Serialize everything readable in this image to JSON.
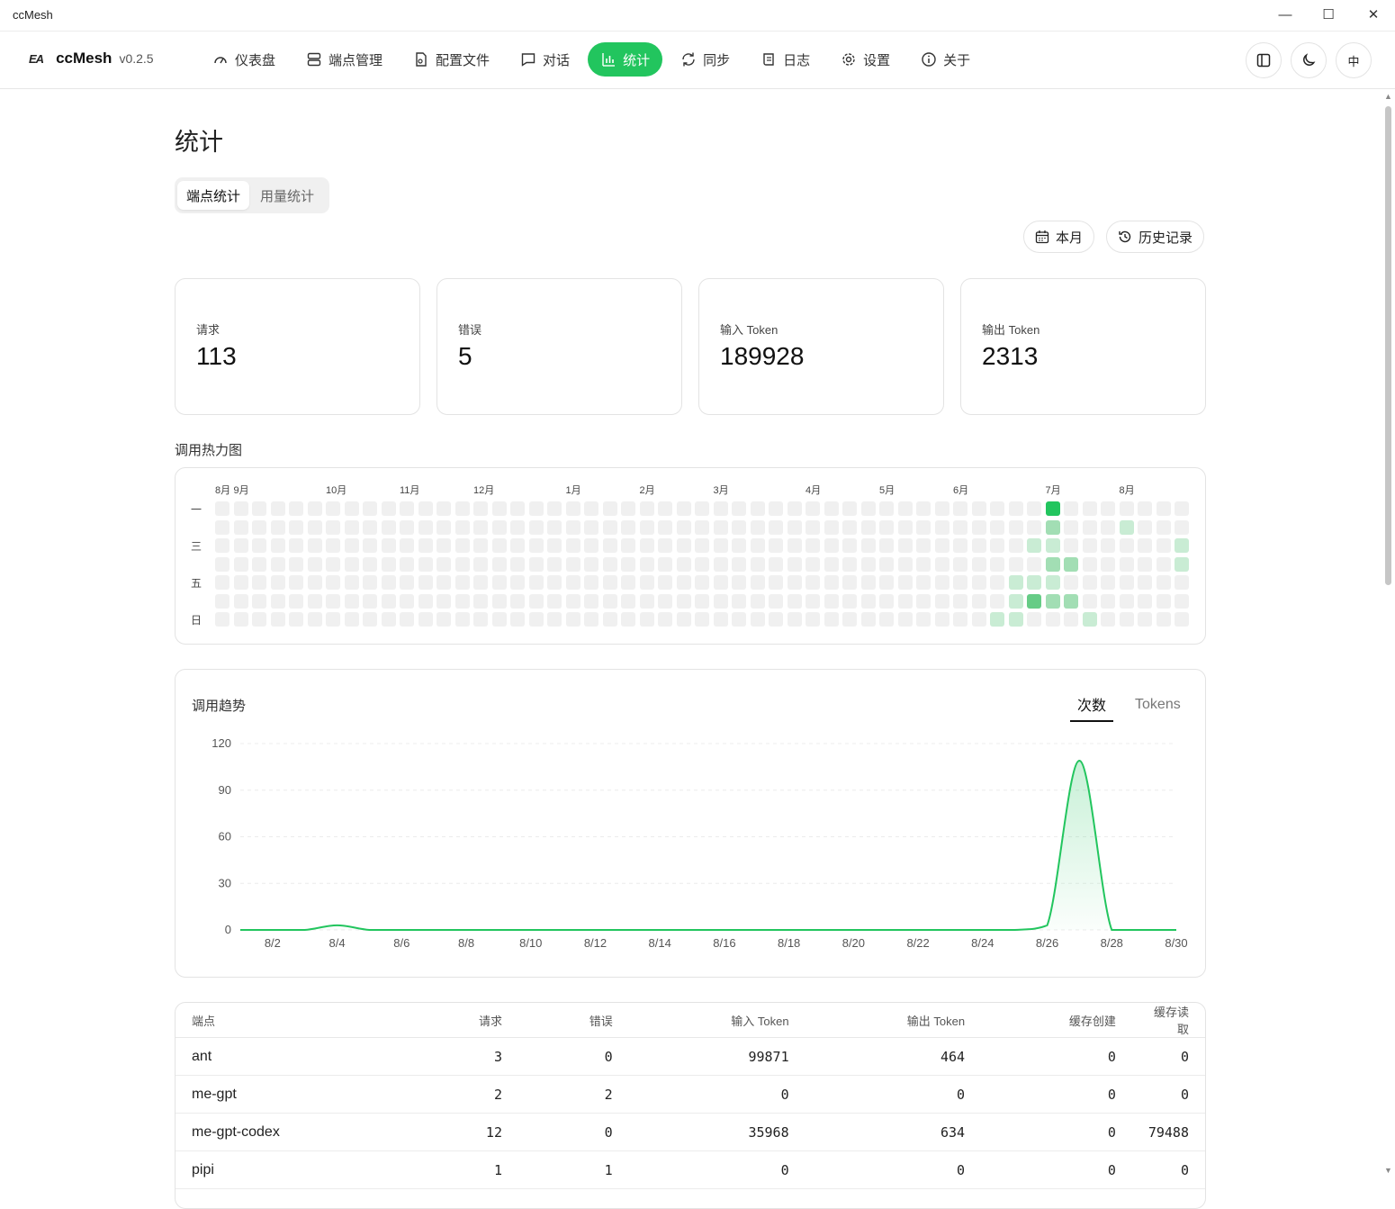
{
  "window": {
    "title": "ccMesh"
  },
  "brand": {
    "logo": "EA",
    "name": "ccMesh",
    "version": "v0.2.5"
  },
  "nav": [
    {
      "label": "仪表盘",
      "icon": "gauge-icon",
      "active": false
    },
    {
      "label": "端点管理",
      "icon": "server-icon",
      "active": false
    },
    {
      "label": "配置文件",
      "icon": "file-icon",
      "active": false
    },
    {
      "label": "对话",
      "icon": "chat-icon",
      "active": false
    },
    {
      "label": "统计",
      "icon": "bar-chart-icon",
      "active": true
    },
    {
      "label": "同步",
      "icon": "sync-icon",
      "active": false
    },
    {
      "label": "日志",
      "icon": "scroll-icon",
      "active": false
    },
    {
      "label": "设置",
      "icon": "gear-icon",
      "active": false
    },
    {
      "label": "关于",
      "icon": "info-icon",
      "active": false
    }
  ],
  "nav_right": {
    "lang": "中"
  },
  "page": {
    "title": "统计"
  },
  "subtabs": [
    {
      "label": "端点统计",
      "active": true
    },
    {
      "label": "用量统计",
      "active": false
    }
  ],
  "filters": {
    "period": "本月",
    "history": "历史记录"
  },
  "stats": [
    {
      "label": "请求",
      "value": "113"
    },
    {
      "label": "错误",
      "value": "5"
    },
    {
      "label": "输入 Token",
      "value": "189928"
    },
    {
      "label": "输出 Token",
      "value": "2313"
    }
  ],
  "heatmap": {
    "title": "调用热力图",
    "months": [
      {
        "label": "8月",
        "col": 0
      },
      {
        "label": "9月",
        "col": 1
      },
      {
        "label": "10月",
        "col": 6
      },
      {
        "label": "11月",
        "col": 10
      },
      {
        "label": "12月",
        "col": 14
      },
      {
        "label": "1月",
        "col": 19
      },
      {
        "label": "2月",
        "col": 23
      },
      {
        "label": "3月",
        "col": 27
      },
      {
        "label": "4月",
        "col": 32
      },
      {
        "label": "5月",
        "col": 36
      },
      {
        "label": "6月",
        "col": 40
      },
      {
        "label": "7月",
        "col": 45
      },
      {
        "label": "8月",
        "col": 49
      }
    ],
    "day_labels": [
      {
        "label": "一",
        "row": 0
      },
      {
        "label": "三",
        "row": 2
      },
      {
        "label": "五",
        "row": 4
      },
      {
        "label": "日",
        "row": 6
      }
    ],
    "weeks": 53,
    "days": 7,
    "active_cells": [
      {
        "col": 45,
        "row": 0,
        "level": 4
      },
      {
        "col": 45,
        "row": 1,
        "level": 2
      },
      {
        "col": 49,
        "row": 1,
        "level": 1
      },
      {
        "col": 44,
        "row": 2,
        "level": 1
      },
      {
        "col": 45,
        "row": 2,
        "level": 1
      },
      {
        "col": 52,
        "row": 2,
        "level": 1
      },
      {
        "col": 45,
        "row": 3,
        "level": 2
      },
      {
        "col": 46,
        "row": 3,
        "level": 2
      },
      {
        "col": 52,
        "row": 3,
        "level": 1
      },
      {
        "col": 43,
        "row": 4,
        "level": 1
      },
      {
        "col": 44,
        "row": 4,
        "level": 1
      },
      {
        "col": 45,
        "row": 4,
        "level": 1
      },
      {
        "col": 43,
        "row": 5,
        "level": 1
      },
      {
        "col": 44,
        "row": 5,
        "level": 3
      },
      {
        "col": 45,
        "row": 5,
        "level": 2
      },
      {
        "col": 46,
        "row": 5,
        "level": 2
      },
      {
        "col": 42,
        "row": 6,
        "level": 1
      },
      {
        "col": 43,
        "row": 6,
        "level": 1
      },
      {
        "col": 47,
        "row": 6,
        "level": 1
      }
    ],
    "colors": {
      "0": "#f0f0f0",
      "1": "#c9ecd4",
      "2": "#a2deb4",
      "3": "#66cc86",
      "4": "#22c55e"
    }
  },
  "trend": {
    "title": "调用趋势",
    "tabs": [
      {
        "label": "次数",
        "active": true
      },
      {
        "label": "Tokens",
        "active": false
      }
    ]
  },
  "chart_data": {
    "type": "area",
    "title": "调用趋势",
    "x": [
      "8/1",
      "8/2",
      "8/3",
      "8/4",
      "8/5",
      "8/6",
      "8/7",
      "8/8",
      "8/9",
      "8/10",
      "8/11",
      "8/12",
      "8/13",
      "8/14",
      "8/15",
      "8/16",
      "8/17",
      "8/18",
      "8/19",
      "8/20",
      "8/21",
      "8/22",
      "8/23",
      "8/24",
      "8/25",
      "8/26",
      "8/27",
      "8/28",
      "8/29",
      "8/30"
    ],
    "xticks": [
      "8/2",
      "8/4",
      "8/6",
      "8/8",
      "8/10",
      "8/12",
      "8/14",
      "8/16",
      "8/18",
      "8/20",
      "8/22",
      "8/24",
      "8/26",
      "8/28",
      "8/30"
    ],
    "series": [
      {
        "values": [
          0,
          0,
          0,
          3,
          0,
          0,
          0,
          0,
          0,
          0,
          0,
          0,
          0,
          0,
          0,
          0,
          0,
          0,
          0,
          0,
          0,
          0,
          0,
          0,
          0,
          3,
          109,
          0,
          0,
          0
        ]
      }
    ],
    "yticks": [
      0,
      30,
      60,
      90,
      120
    ],
    "ylim": [
      0,
      120
    ],
    "grid": true,
    "color": "#22c55e"
  },
  "table": {
    "headers": [
      "端点",
      "请求",
      "错误",
      "输入 Token",
      "输出 Token",
      "缓存创建",
      "缓存读取"
    ],
    "rows": [
      [
        "ant",
        "3",
        "0",
        "99871",
        "464",
        "0",
        "0"
      ],
      [
        "me-gpt",
        "2",
        "2",
        "0",
        "0",
        "0",
        "0"
      ],
      [
        "me-gpt-codex",
        "12",
        "0",
        "35968",
        "634",
        "0",
        "79488"
      ],
      [
        "pipi",
        "1",
        "1",
        "0",
        "0",
        "0",
        "0"
      ]
    ]
  }
}
